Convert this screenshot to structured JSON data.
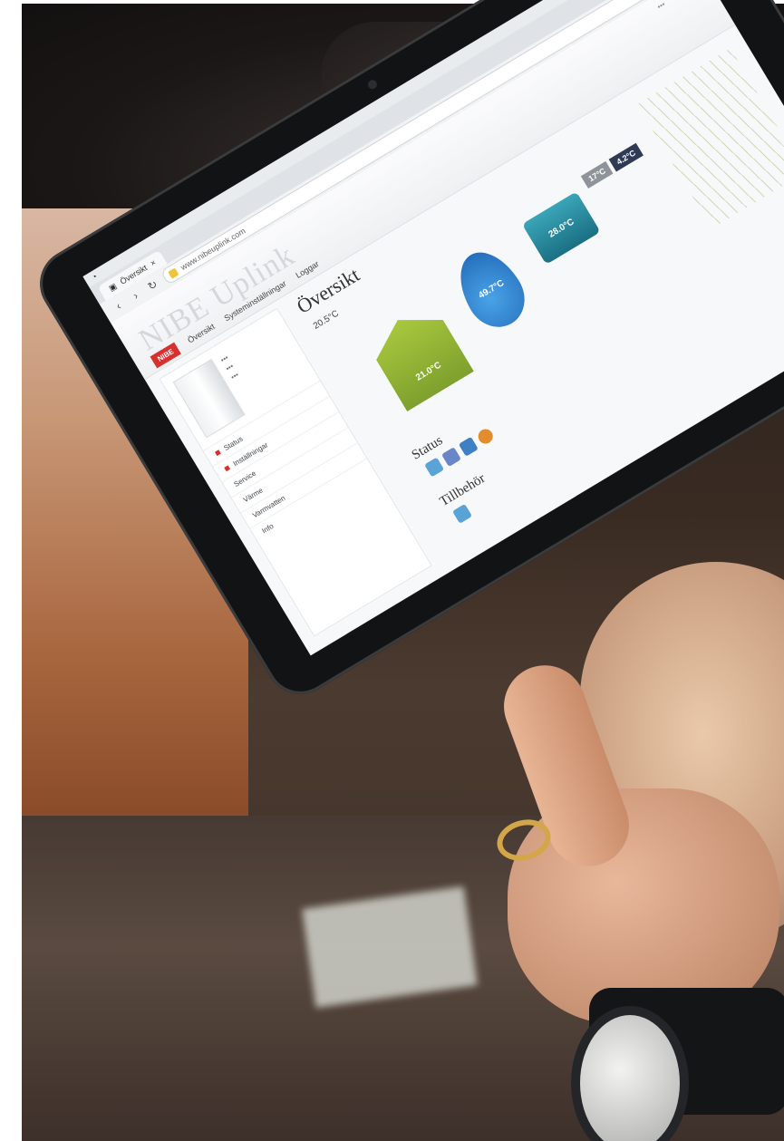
{
  "browser": {
    "tab_title": "Översikt",
    "url": "www.nibeuplink.com"
  },
  "page": {
    "brand": "NIBE Uplink",
    "badge": "NIBE",
    "title": "Översikt",
    "temperature_small": "20.5°C",
    "sections": {
      "status": "Status",
      "accessories": "Tillbehör"
    },
    "diagram": {
      "house_temp": "21.0°C",
      "water_temp": "49.7°C",
      "tank_temp": "28.0°C",
      "outdoor_1": "17°C",
      "outdoor_2": "4.2°C"
    },
    "menu": [
      "Översikt",
      "Systeminställningar",
      "Loggar"
    ],
    "sidebar": [
      "Status",
      "Inställningar",
      "Service",
      "Värme",
      "Varmvatten",
      "Info"
    ]
  }
}
